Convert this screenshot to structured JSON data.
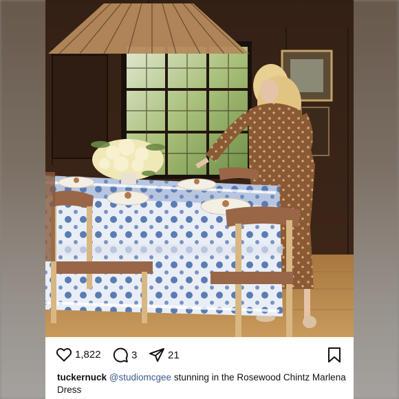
{
  "post": {
    "photo_alt": "",
    "likes": "1,822",
    "comments": "3",
    "shares": "21",
    "caption": {
      "username": "tuckernuck",
      "mention": "@studiomcgee",
      "text": "stunning in the Rosewood Chintz Marlena Dress"
    }
  },
  "icons": {
    "like": "heart-outline-icon",
    "comment": "speech-bubble-icon",
    "share": "paper-plane-icon",
    "save": "bookmark-icon"
  },
  "colors": {
    "text": "#111111",
    "mention": "#3b5a8a",
    "background_blur": "#8a8684"
  }
}
